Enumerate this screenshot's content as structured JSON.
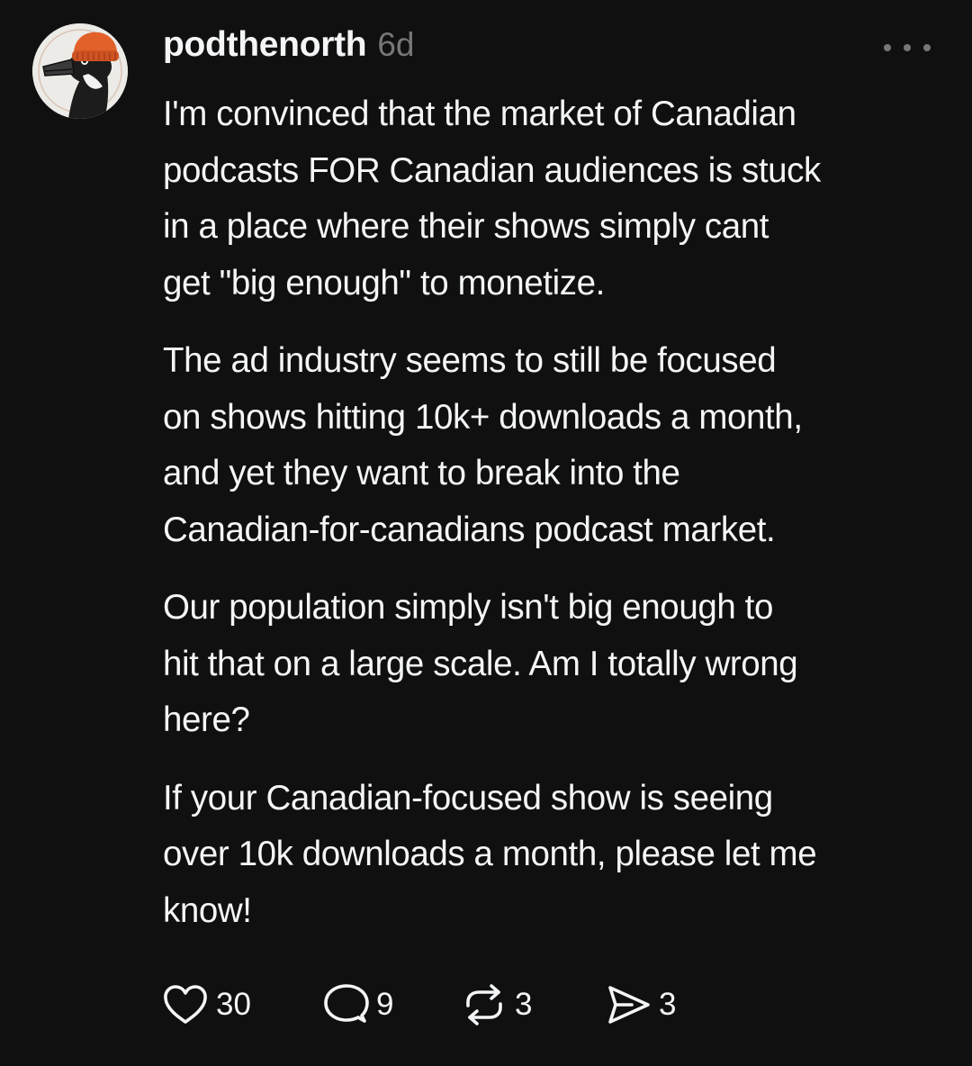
{
  "post": {
    "username": "podthenorth",
    "time": "6d",
    "paragraphs": [
      {
        "lines": [
          "I'm convinced that the market of Canadian",
          "podcasts FOR Canadian audiences is stuck",
          "in a place where their shows simply cant",
          "get \"big enough\" to monetize."
        ]
      },
      {
        "lines": [
          "The ad industry seems to still be focused",
          "on shows hitting 10k+ downloads a month,",
          "and yet they want to break into the",
          "Canadian-for-canadians podcast market."
        ]
      },
      {
        "lines": [
          "Our population simply isn't big enough to",
          "hit that on a large scale. Am I totally wrong",
          "here?"
        ]
      },
      {
        "lines": [
          "If your Canadian-focused show is seeing",
          "over 10k downloads a month, please let me",
          "know!"
        ]
      }
    ],
    "actions": {
      "likes": "30",
      "comments": "9",
      "reposts": "3",
      "shares": "3"
    }
  },
  "icons": {
    "avatar": "goose-with-orange-beanie",
    "more": "more-horizontal-icon",
    "like": "heart-icon",
    "comment": "comment-icon",
    "repost": "repost-icon",
    "share": "send-icon"
  },
  "colors": {
    "background": "#101010",
    "text": "#f3f5f7",
    "muted": "#777777",
    "beanie": "#e2612b"
  }
}
